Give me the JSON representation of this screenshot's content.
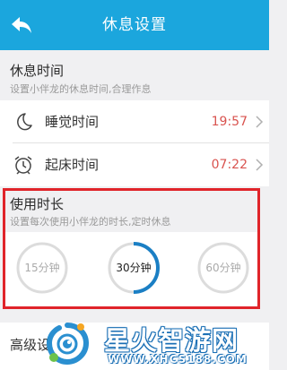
{
  "header": {
    "title": "休息设置",
    "back_icon": "back-arrow-icon",
    "background": "#1ba6dd"
  },
  "rest_time": {
    "title": "休息时间",
    "description": "设置小伴龙的休息时间,合理作息",
    "items": [
      {
        "icon": "moon-icon",
        "label": "睡觉时间",
        "value": "19:57"
      },
      {
        "icon": "alarm-clock-icon",
        "label": "起床时间",
        "value": "07:22"
      }
    ]
  },
  "usage_duration": {
    "title": "使用时长",
    "description": "设置每次使用小伴龙的时长,定时休息",
    "options": [
      {
        "label": "15分钟",
        "selected": false,
        "progress": 0
      },
      {
        "label": "30分钟",
        "selected": true,
        "progress": 0.5
      },
      {
        "label": "60分钟",
        "selected": false,
        "progress": 0
      }
    ],
    "highlight_color": "#e0242a"
  },
  "advanced": {
    "label": "高级设"
  },
  "watermark": {
    "title": "星火智游网",
    "url": "WWW.XHCS188.COM"
  },
  "colors": {
    "accent": "#1ba6dd",
    "time_value": "#d9534f",
    "ring_track": "#dcdcdc",
    "ring_active": "#1b7fc4"
  }
}
